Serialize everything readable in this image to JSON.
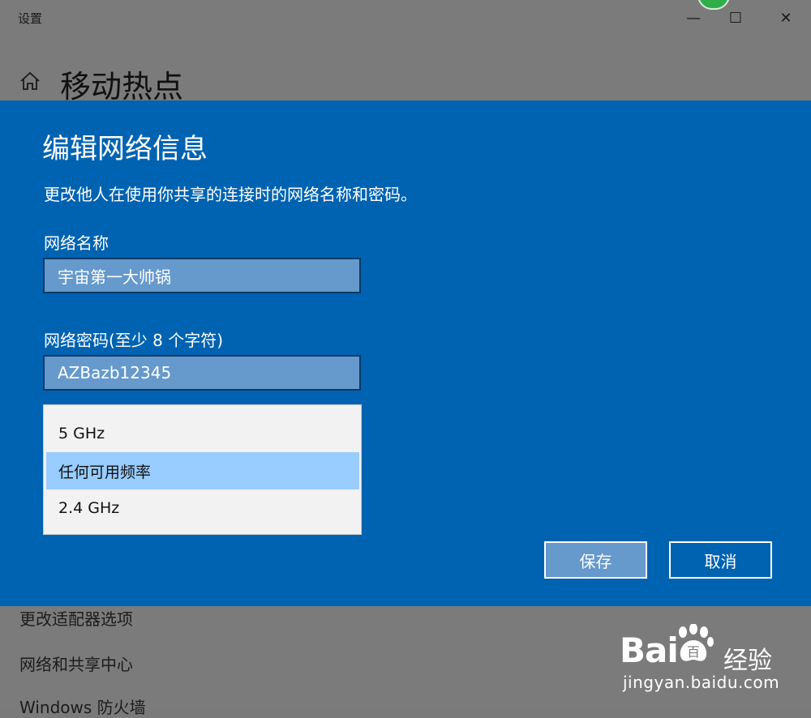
{
  "window": {
    "app_title": "设置",
    "minimize": "—",
    "maximize": "☐",
    "close": "✕"
  },
  "page": {
    "title": "移动热点",
    "links": [
      "更改适配器选项",
      "网络和共享中心",
      "Windows 防火墙"
    ]
  },
  "dialog": {
    "title": "编辑网络信息",
    "description": "更改他人在使用你共享的连接时的网络名称和密码。",
    "network_name_label": "网络名称",
    "network_name_value": "宇宙第一大帅锅",
    "password_label": "网络密码(至少 8 个字符)",
    "password_value": "AZBazb12345",
    "band_options": [
      "5 GHz",
      "任何可用频率",
      "2.4 GHz"
    ],
    "band_selected": "任何可用频率",
    "save_label": "保存",
    "cancel_label": "取消"
  },
  "watermark": {
    "brand_left": "Bai",
    "brand_right": "百",
    "product": "经验",
    "url": "jingyan.baidu.com"
  },
  "colors": {
    "dialog_bg": "#0063b1",
    "input_bg": "#6699cc",
    "selected_option": "#99ccff",
    "overlay_bg": "#7b7b7b"
  }
}
